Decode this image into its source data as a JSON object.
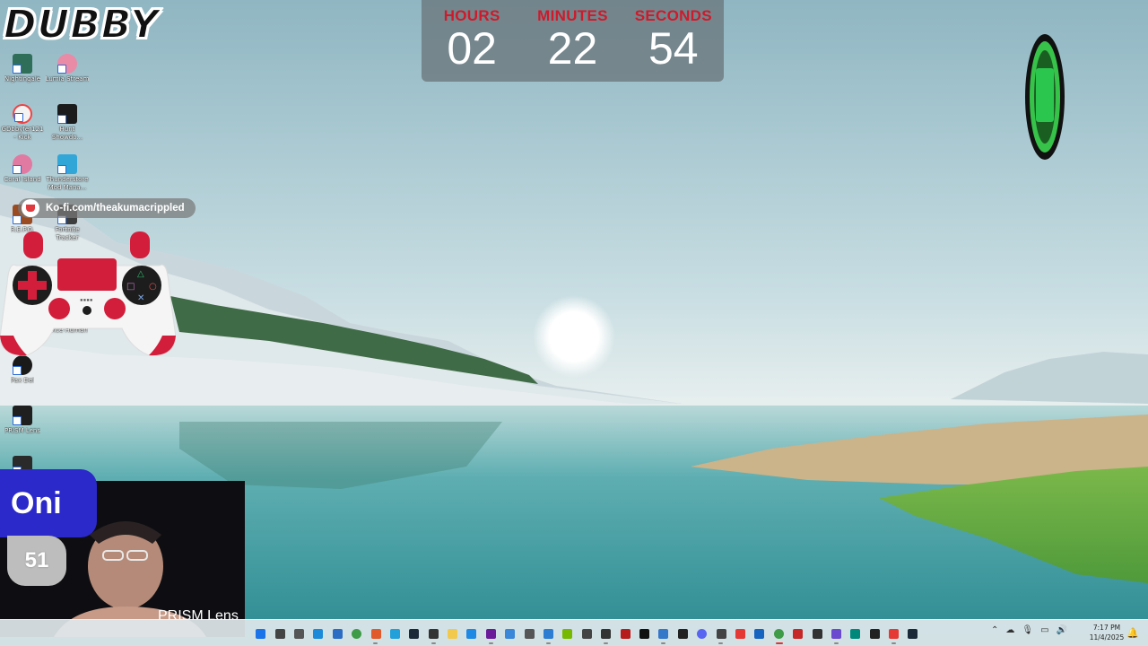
{
  "stream_title": "DUBBY",
  "countdown": {
    "hours_label": "HOURS",
    "hours": "02",
    "minutes_label": "MINUTES",
    "minutes": "22",
    "seconds_label": "SECONDS",
    "seconds": "54"
  },
  "desktop_icons": [
    {
      "label": "Nightingale"
    },
    {
      "label": "Lumia Stream"
    },
    {
      "label": "GDbbyfer121 - Kick"
    },
    {
      "label": "Hunt Showdo..."
    },
    {
      "label": "Coral Island"
    },
    {
      "label": "Thunderstore Mod Mana..."
    },
    {
      "label": "R.E.P.O."
    },
    {
      "label": "Fortnite Tracker"
    },
    {
      "label": "Once Human"
    },
    {
      "label": "Pax Dei"
    },
    {
      "label": "PRISM Lens"
    }
  ],
  "kofi": {
    "text": "Ko-fi.com/theakumacrippled"
  },
  "webcam": {
    "name": "Oni",
    "level": "51",
    "watermark": "PRISM Lens"
  },
  "taskbar": {
    "time": "7:17 PM",
    "date": "11/4/2025",
    "apps": [
      {
        "icon": "windows-start-icon",
        "color": "#1a73e8"
      },
      {
        "icon": "search-icon",
        "color": "#444444"
      },
      {
        "icon": "task-view-icon",
        "color": "#555555"
      },
      {
        "icon": "edge-icon",
        "color": "#1b8ad8"
      },
      {
        "icon": "store-icon",
        "color": "#2c6cc4"
      },
      {
        "icon": "chrome-icon",
        "color": "#3e9b47"
      },
      {
        "icon": "app-icon",
        "color": "#e05a2b"
      },
      {
        "icon": "app-icon",
        "color": "#22a0d9"
      },
      {
        "icon": "steam-icon",
        "color": "#1b2838"
      },
      {
        "icon": "app-icon",
        "color": "#333333"
      },
      {
        "icon": "folder-icon",
        "color": "#f2c94c"
      },
      {
        "icon": "app-icon",
        "color": "#1e88e5"
      },
      {
        "icon": "app-icon",
        "color": "#6a1b9a"
      },
      {
        "icon": "app-icon",
        "color": "#3a86d8"
      },
      {
        "icon": "app-icon",
        "color": "#555555"
      },
      {
        "icon": "app-icon",
        "color": "#2d7dd2"
      },
      {
        "icon": "nvidia-icon",
        "color": "#76b900"
      },
      {
        "icon": "app-icon",
        "color": "#444444"
      },
      {
        "icon": "app-icon",
        "color": "#333333"
      },
      {
        "icon": "app-icon",
        "color": "#b71c1c"
      },
      {
        "icon": "tiktok-icon",
        "color": "#111111"
      },
      {
        "icon": "app-icon",
        "color": "#3577c9"
      },
      {
        "icon": "app-icon",
        "color": "#222222"
      },
      {
        "icon": "discord-icon",
        "color": "#5865f2"
      },
      {
        "icon": "app-icon",
        "color": "#444444"
      },
      {
        "icon": "app-icon",
        "color": "#e53935"
      },
      {
        "icon": "app-icon",
        "color": "#1565c0"
      },
      {
        "icon": "chrome-icon",
        "color": "#3e9b47"
      },
      {
        "icon": "app-icon",
        "color": "#c62828"
      },
      {
        "icon": "app-icon",
        "color": "#333333"
      },
      {
        "icon": "app-icon",
        "color": "#6c4ad0"
      },
      {
        "icon": "app-icon",
        "color": "#00897b"
      },
      {
        "icon": "app-icon",
        "color": "#222222"
      },
      {
        "icon": "app-icon",
        "color": "#e53935"
      },
      {
        "icon": "steam-icon",
        "color": "#1b2838"
      }
    ]
  },
  "colors": {
    "countdown_label": "#d0192b",
    "badge_blue": "#2b29c9",
    "kofi_red": "#e0393e"
  }
}
